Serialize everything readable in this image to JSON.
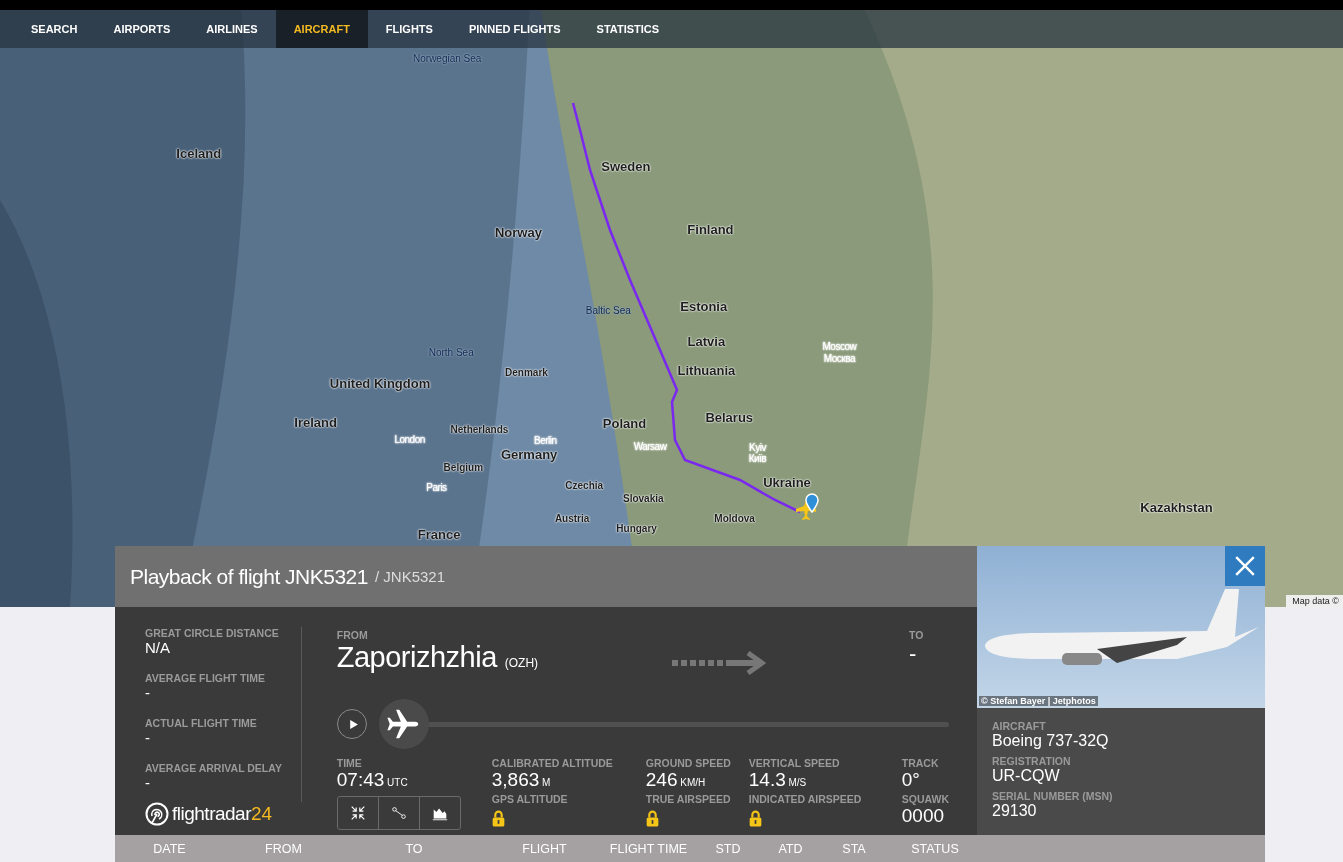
{
  "nav": [
    {
      "label": "SEARCH",
      "selected": false
    },
    {
      "label": "AIRPORTS",
      "selected": false
    },
    {
      "label": "AIRLINES",
      "selected": false
    },
    {
      "label": "AIRCRAFT",
      "selected": true
    },
    {
      "label": "FLIGHTS",
      "selected": false
    },
    {
      "label": "PINNED FLIGHTS",
      "selected": false
    },
    {
      "label": "STATISTICS",
      "selected": false
    }
  ],
  "map": {
    "labels": [
      {
        "text": "Norwegian Sea",
        "kind": "sea"
      },
      {
        "text": "Iceland",
        "kind": "country"
      },
      {
        "text": "Sweden",
        "kind": "country"
      },
      {
        "text": "Finland",
        "kind": "country"
      },
      {
        "text": "Norway",
        "kind": "country"
      },
      {
        "text": "Baltic Sea",
        "kind": "sea"
      },
      {
        "text": "Estonia",
        "kind": "country"
      },
      {
        "text": "North Sea",
        "kind": "sea"
      },
      {
        "text": "Latvia",
        "kind": "country"
      },
      {
        "text": "Moscow",
        "kind": "city"
      },
      {
        "text": "Москва",
        "kind": "city"
      },
      {
        "text": "Denmark",
        "kind": "minor"
      },
      {
        "text": "United Kingdom",
        "kind": "country"
      },
      {
        "text": "Lithuania",
        "kind": "country"
      },
      {
        "text": "Ireland",
        "kind": "country"
      },
      {
        "text": "Poland",
        "kind": "country"
      },
      {
        "text": "Belarus",
        "kind": "country"
      },
      {
        "text": "London",
        "kind": "city"
      },
      {
        "text": "Netherlands",
        "kind": "minor"
      },
      {
        "text": "Berlin",
        "kind": "city"
      },
      {
        "text": "Warsaw",
        "kind": "city"
      },
      {
        "text": "Kyiv",
        "kind": "city"
      },
      {
        "text": "Київ",
        "kind": "city"
      },
      {
        "text": "Germany",
        "kind": "country"
      },
      {
        "text": "Belgium",
        "kind": "minor"
      },
      {
        "text": "Paris",
        "kind": "city"
      },
      {
        "text": "Czechia",
        "kind": "minor"
      },
      {
        "text": "Ukraine",
        "kind": "country"
      },
      {
        "text": "Slovakia",
        "kind": "minor"
      },
      {
        "text": "Kazakhstan",
        "kind": "country"
      },
      {
        "text": "Austria",
        "kind": "minor"
      },
      {
        "text": "Hungary",
        "kind": "minor"
      },
      {
        "text": "Moldova",
        "kind": "minor"
      },
      {
        "text": "France",
        "kind": "country"
      }
    ],
    "attribution": "Map data ©"
  },
  "panel": {
    "title": "Playback of flight JNK5321",
    "subtitle": "/ JNK5321",
    "stats": [
      {
        "label": "GREAT CIRCLE DISTANCE",
        "value": "N/A"
      },
      {
        "label": "AVERAGE FLIGHT TIME",
        "value": "-"
      },
      {
        "label": "ACTUAL FLIGHT TIME",
        "value": "-"
      },
      {
        "label": "AVERAGE ARRIVAL DELAY",
        "value": "-"
      }
    ],
    "logo": {
      "name": "flightradar",
      "number": "24"
    },
    "from": {
      "label": "FROM",
      "city": "Zaporizhzhia",
      "code": "(OZH)"
    },
    "to": {
      "label": "TO",
      "value": "-"
    },
    "playback": {
      "level": 0
    },
    "readings": [
      {
        "label": "TIME",
        "value": "07:43",
        "unit": "UTC"
      },
      {
        "label": "CALIBRATED ALTITUDE",
        "value": "3,863",
        "unit": "M"
      },
      {
        "label": "GROUND SPEED",
        "value": "246",
        "unit": "KM/H"
      },
      {
        "label": "VERTICAL SPEED",
        "value": "14.3",
        "unit": "M/S"
      },
      {
        "label": "TRACK",
        "value": "0°"
      }
    ],
    "readings_lower": [
      {
        "kind": "locked",
        "label": "GPS ALTITUDE"
      },
      {
        "kind": "locked",
        "label": "TRUE AIRSPEED"
      },
      {
        "kind": "locked",
        "label": "INDICATED AIRSPEED"
      },
      {
        "kind": "value",
        "label": "SQUAWK",
        "value": "0000"
      }
    ],
    "photo_credit": "© Stefan Bayer | Jetphotos",
    "details": [
      {
        "label": "AIRCRAFT",
        "value": "Boeing 737-32Q"
      },
      {
        "label": "REGISTRATION",
        "value": "UR-CQW"
      },
      {
        "label": "SERIAL NUMBER (MSN)",
        "value": "29130"
      }
    ]
  },
  "table": {
    "columns": [
      "DATE",
      "FROM",
      "TO",
      "FLIGHT",
      "FLIGHT TIME",
      "STD",
      "ATD",
      "STA",
      "STATUS"
    ]
  }
}
